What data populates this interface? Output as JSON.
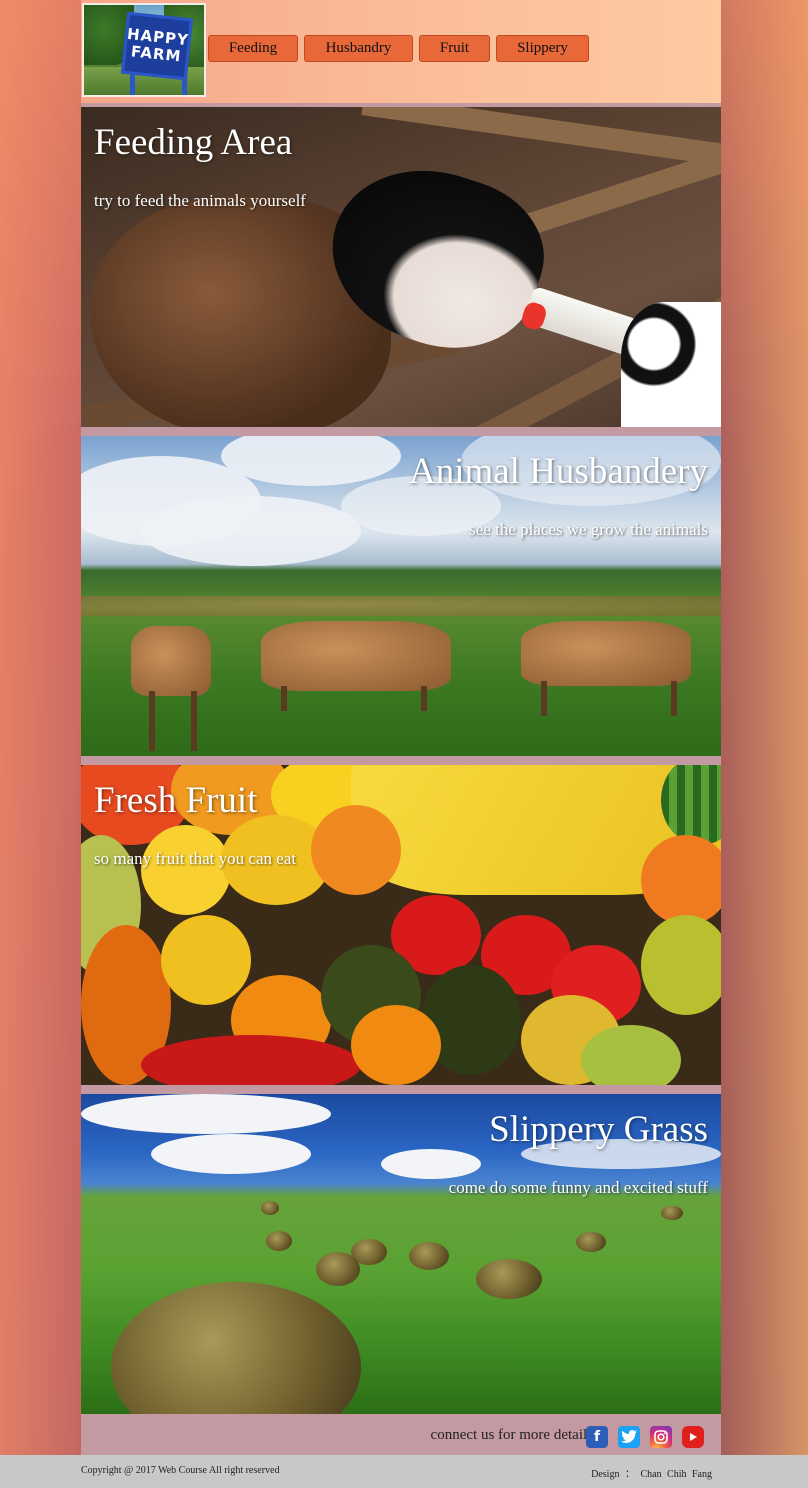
{
  "header": {
    "logo_text_line1": "HAPPY",
    "logo_text_line2": "FARM",
    "nav": [
      "Feeding",
      "Husbandry",
      "Fruit",
      "Slippery"
    ]
  },
  "sections": [
    {
      "title": "Feeding Area",
      "subtitle": "try to feed the animals yourself"
    },
    {
      "title": "Animal Husbandery",
      "subtitle": "see the places we grow the animals"
    },
    {
      "title": "Fresh Fruit",
      "subtitle": "so many fruit that you can eat"
    },
    {
      "title": "Slippery Grass",
      "subtitle": "come do some funny and excited stuff"
    }
  ],
  "footer": {
    "connect_text": "connect us for more details",
    "socials": [
      "facebook-icon",
      "twitter-icon",
      "instagram-icon",
      "youtube-icon"
    ],
    "copyright": "Copyright @ 2017 Web Course All right reserved",
    "design_credit": "Design ： Chan Chih Fang"
  },
  "colors": {
    "nav_button": "#e8683a",
    "header_bg": "#fbbf9b",
    "footer_bar": "#c49aa2",
    "copyright_bar": "#c8c8c8"
  }
}
